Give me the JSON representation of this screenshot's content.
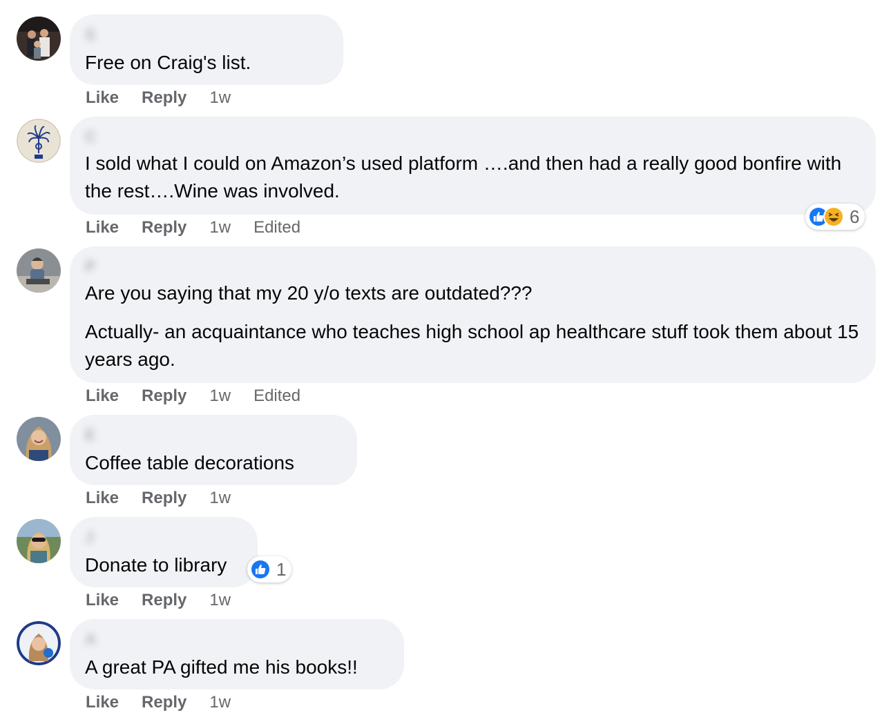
{
  "labels": {
    "like": "Like",
    "reply": "Reply"
  },
  "colors": {
    "bubble": "#f0f2f5",
    "meta_text": "#65676b",
    "like_reaction": "#1877f2",
    "haha_reaction": "#f7b125"
  },
  "comments": [
    {
      "author_visible": "S",
      "body": [
        "Free on Craig's list."
      ],
      "time": "1w",
      "edited": "",
      "reactions": null
    },
    {
      "author_visible": "C",
      "body": [
        "I sold what I could on Amazon’s used platform ….and then had a really good bonfire with the rest….Wine was involved."
      ],
      "time": "1w",
      "edited": "Edited",
      "reactions": {
        "icons": [
          "like-icon",
          "haha-icon"
        ],
        "count": "6"
      }
    },
    {
      "author_visible": "P",
      "body": [
        "Are you saying that my 20 y/o texts are outdated???",
        "Actually- an acquaintance who teaches high school ap healthcare stuff took them about 15 years ago."
      ],
      "time": "1w",
      "edited": "Edited",
      "reactions": null
    },
    {
      "author_visible": "E",
      "body": [
        "Coffee table decorations"
      ],
      "time": "1w",
      "edited": "",
      "reactions": null
    },
    {
      "author_visible": "J",
      "body": [
        "Donate to library"
      ],
      "time": "1w",
      "edited": "",
      "reactions": {
        "icons": [
          "like-icon"
        ],
        "count": "1"
      }
    },
    {
      "author_visible": "A",
      "body": [
        "A great PA gifted me his books!!"
      ],
      "time": "1w",
      "edited": "",
      "reactions": null
    }
  ]
}
